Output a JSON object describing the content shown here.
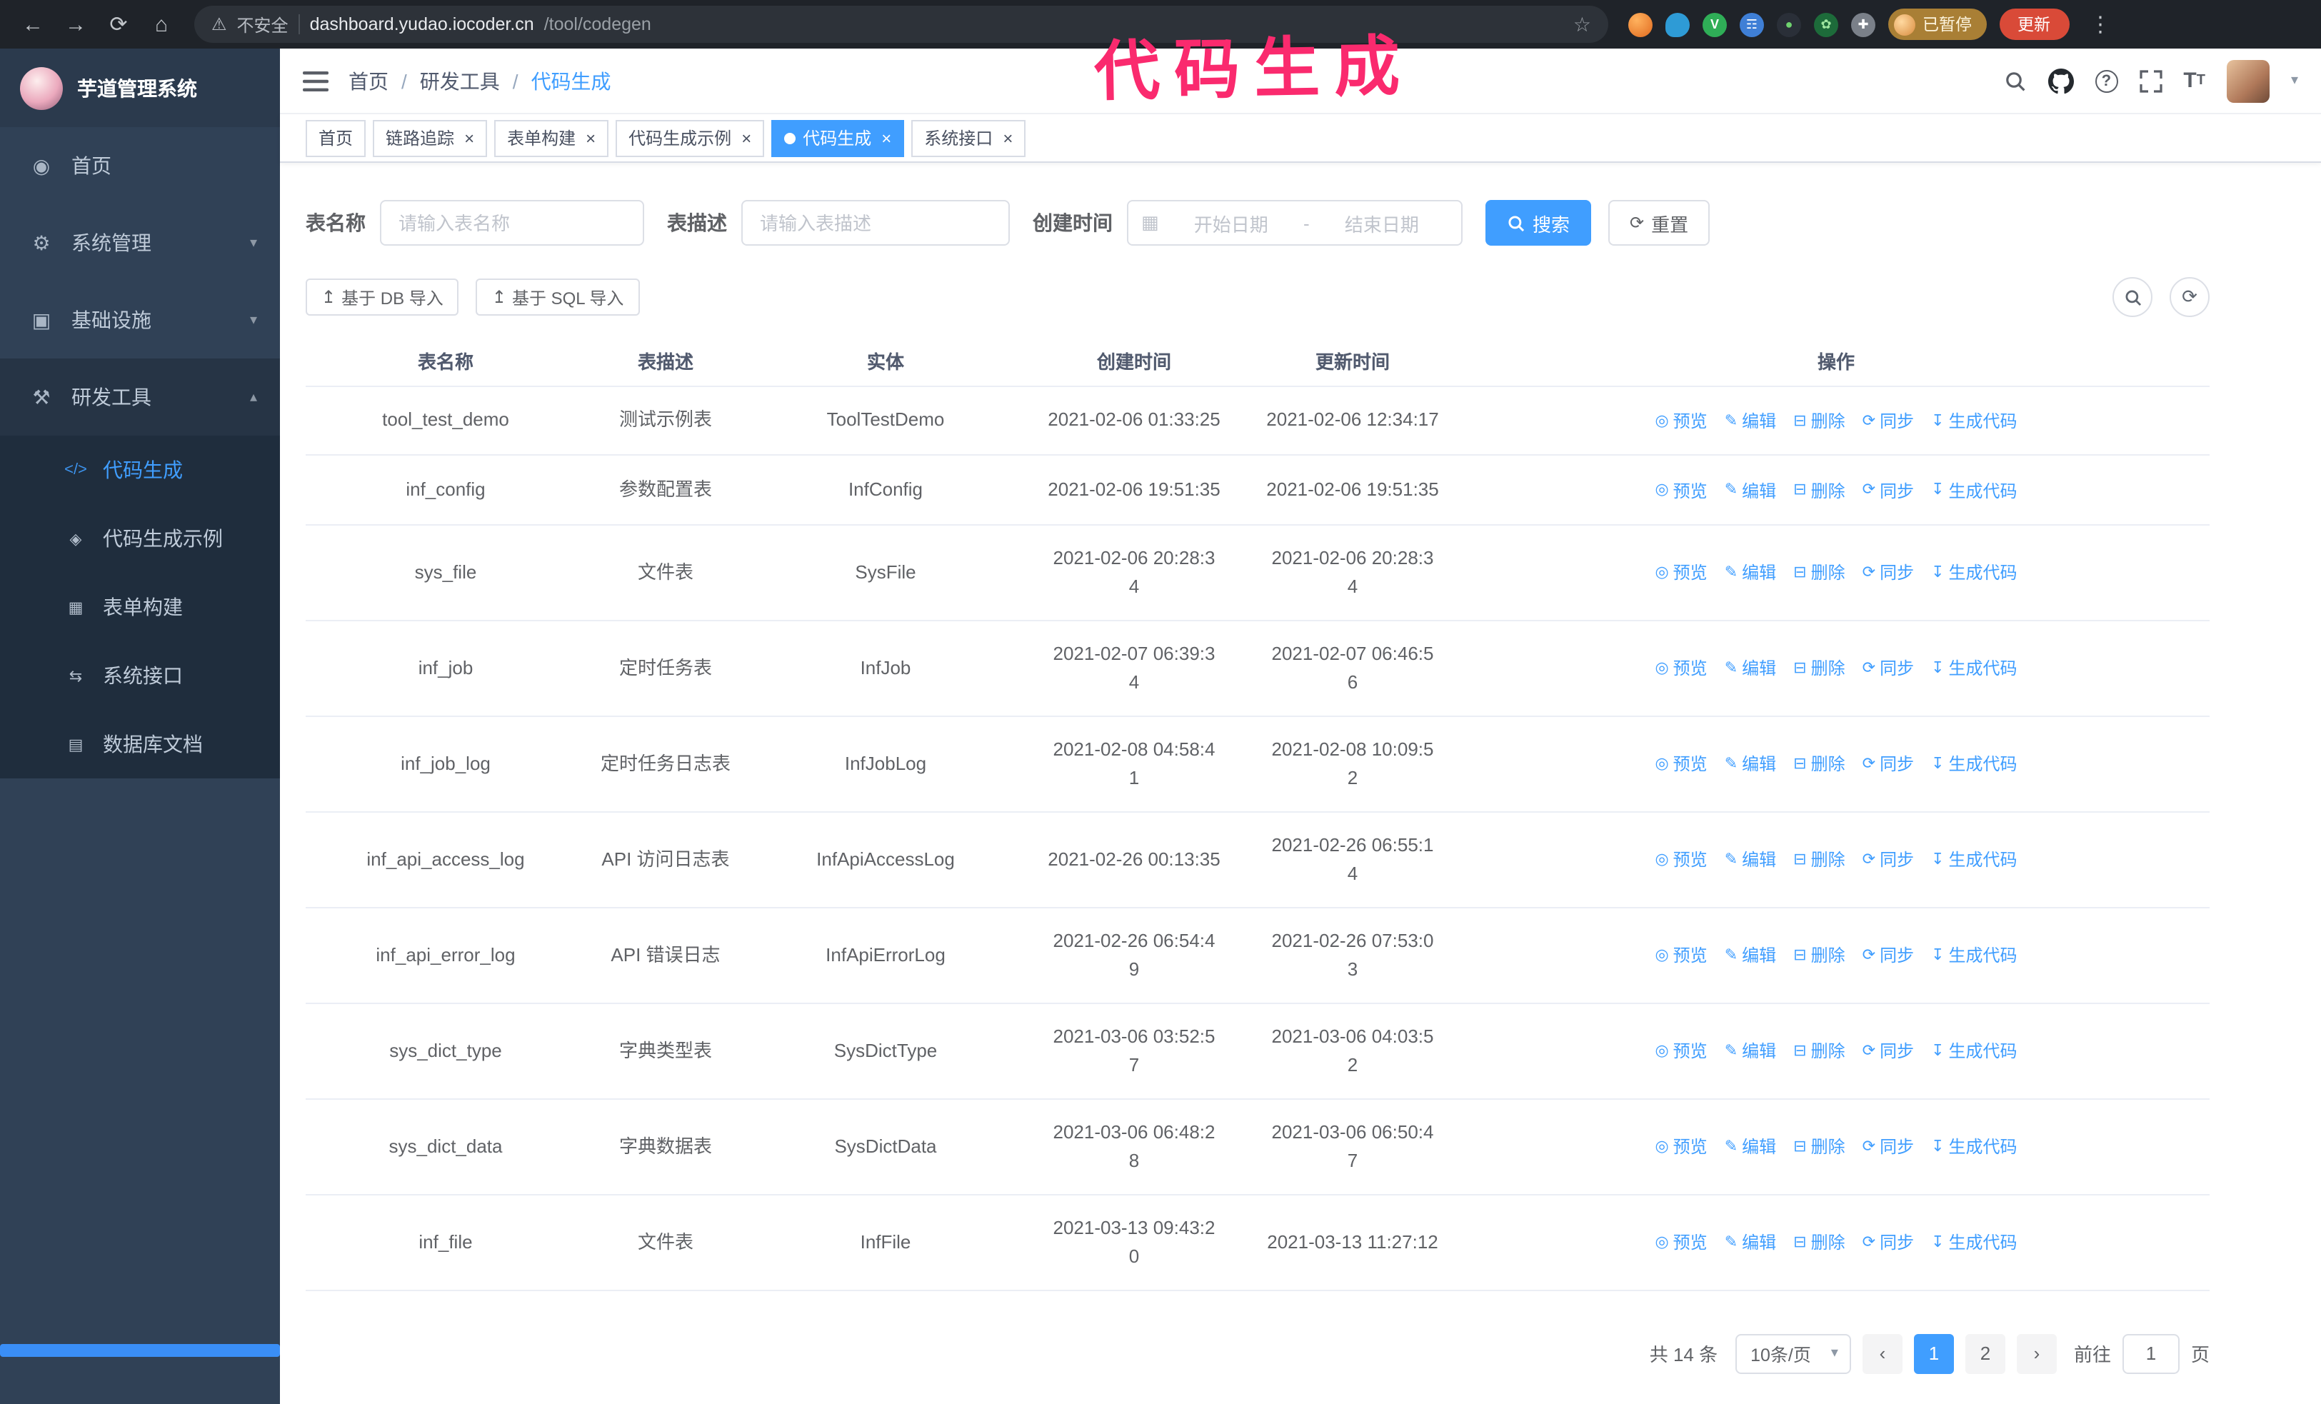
{
  "browser": {
    "security_label": "不安全",
    "url_host": "dashboard.yudao.iocoder.cn",
    "url_path": "/tool/codegen",
    "paused_badge": "已暂停",
    "update_label": "更新"
  },
  "annotation": {
    "text": "代码生成"
  },
  "sidebar": {
    "logo_title": "芋道管理系统",
    "menu": [
      {
        "key": "home",
        "label": "首页",
        "icon": "home-icon",
        "arrow": "",
        "open": false
      },
      {
        "key": "system",
        "label": "系统管理",
        "icon": "gear-icon",
        "arrow": "down",
        "open": false
      },
      {
        "key": "infrastructure",
        "label": "基础设施",
        "icon": "monitor-icon",
        "arrow": "down",
        "open": false
      },
      {
        "key": "devtools",
        "label": "研发工具",
        "icon": "tools-icon",
        "arrow": "up",
        "open": true
      }
    ],
    "submenu": [
      {
        "key": "codegen",
        "label": "代码生成",
        "icon": "code-icon",
        "active": true
      },
      {
        "key": "codegen-demo",
        "label": "代码生成示例",
        "icon": "badge-icon",
        "active": false
      },
      {
        "key": "form-builder",
        "label": "表单构建",
        "icon": "form-icon",
        "active": false
      },
      {
        "key": "api",
        "label": "系统接口",
        "icon": "api-icon",
        "active": false
      },
      {
        "key": "db-doc",
        "label": "数据库文档",
        "icon": "database-icon",
        "active": false
      }
    ]
  },
  "header": {
    "breadcrumb": [
      {
        "label": "首页",
        "current": false
      },
      {
        "label": "研发工具",
        "current": false
      },
      {
        "label": "代码生成",
        "current": true
      }
    ]
  },
  "tabs": [
    {
      "key": "home",
      "label": "首页",
      "closable": false,
      "active": false
    },
    {
      "key": "tracer",
      "label": "链路追踪",
      "closable": true,
      "active": false
    },
    {
      "key": "form-builder",
      "label": "表单构建",
      "closable": true,
      "active": false
    },
    {
      "key": "codegen-demo",
      "label": "代码生成示例",
      "closable": true,
      "active": false
    },
    {
      "key": "codegen",
      "label": "代码生成",
      "closable": true,
      "active": true
    },
    {
      "key": "api",
      "label": "系统接口",
      "closable": true,
      "active": false
    }
  ],
  "filters": {
    "name_label": "表名称",
    "name_placeholder": "请输入表名称",
    "desc_label": "表描述",
    "desc_placeholder": "请输入表描述",
    "time_label": "创建时间",
    "start_placeholder": "开始日期",
    "range_separator": "-",
    "end_placeholder": "结束日期",
    "search_label": "搜索",
    "reset_label": "重置"
  },
  "toolbar": {
    "import_db_label": "基于 DB 导入",
    "import_sql_label": "基于 SQL 导入"
  },
  "table": {
    "columns": [
      "表名称",
      "表描述",
      "实体",
      "创建时间",
      "更新时间",
      "操作"
    ],
    "actions": [
      {
        "key": "preview",
        "label": "预览",
        "icon": "eye-icon"
      },
      {
        "key": "edit",
        "label": "编辑",
        "icon": "edit-icon"
      },
      {
        "key": "delete",
        "label": "删除",
        "icon": "delete-icon"
      },
      {
        "key": "sync",
        "label": "同步",
        "icon": "sync-icon"
      },
      {
        "key": "generate",
        "label": "生成代码",
        "icon": "generate-code-icon"
      }
    ],
    "rows": [
      {
        "name": "tool_test_demo",
        "description": "测试示例表",
        "entity": "ToolTestDemo",
        "create_time": "2021-02-06 01:33:25",
        "update_time": "2021-02-06 12:34:17"
      },
      {
        "name": "inf_config",
        "description": "参数配置表",
        "entity": "InfConfig",
        "create_time": "2021-02-06 19:51:35",
        "update_time": "2021-02-06 19:51:35"
      },
      {
        "name": "sys_file",
        "description": "文件表",
        "entity": "SysFile",
        "create_time": "2021-02-06 20:28:3\n4",
        "update_time": "2021-02-06 20:28:3\n4"
      },
      {
        "name": "inf_job",
        "description": "定时任务表",
        "entity": "InfJob",
        "create_time": "2021-02-07 06:39:3\n4",
        "update_time": "2021-02-07 06:46:5\n6"
      },
      {
        "name": "inf_job_log",
        "description": "定时任务日志表",
        "entity": "InfJobLog",
        "create_time": "2021-02-08 04:58:4\n1",
        "update_time": "2021-02-08 10:09:5\n2"
      },
      {
        "name": "inf_api_access_log",
        "description": "API 访问日志表",
        "entity": "InfApiAccessLog",
        "create_time": "2021-02-26 00:13:35",
        "update_time": "2021-02-26 06:55:1\n4"
      },
      {
        "name": "inf_api_error_log",
        "description": "API 错误日志",
        "entity": "InfApiErrorLog",
        "create_time": "2021-02-26 06:54:4\n9",
        "update_time": "2021-02-26 07:53:0\n3"
      },
      {
        "name": "sys_dict_type",
        "description": "字典类型表",
        "entity": "SysDictType",
        "create_time": "2021-03-06 03:52:5\n7",
        "update_time": "2021-03-06 04:03:5\n2"
      },
      {
        "name": "sys_dict_data",
        "description": "字典数据表",
        "entity": "SysDictData",
        "create_time": "2021-03-06 06:48:2\n8",
        "update_time": "2021-03-06 06:50:4\n7"
      },
      {
        "name": "inf_file",
        "description": "文件表",
        "entity": "InfFile",
        "create_time": "2021-03-13 09:43:2\n0",
        "update_time": "2021-03-13 11:27:12"
      }
    ]
  },
  "pagination": {
    "total_text": "共 14 条",
    "page_size_text": "10条/页",
    "pages": [
      "1",
      "2"
    ],
    "active_page": "1",
    "goto_label": "前往",
    "goto_value": "1",
    "goto_unit": "页"
  },
  "colors": {
    "accent": "#409eff",
    "sidebar_bg": "#304156",
    "sidebar_submenu_bg": "#1f2d3d",
    "annotation_pink": "#fa2a6e",
    "update_button_red": "#d94a38",
    "paused_badge_amber": "#a97f35"
  }
}
